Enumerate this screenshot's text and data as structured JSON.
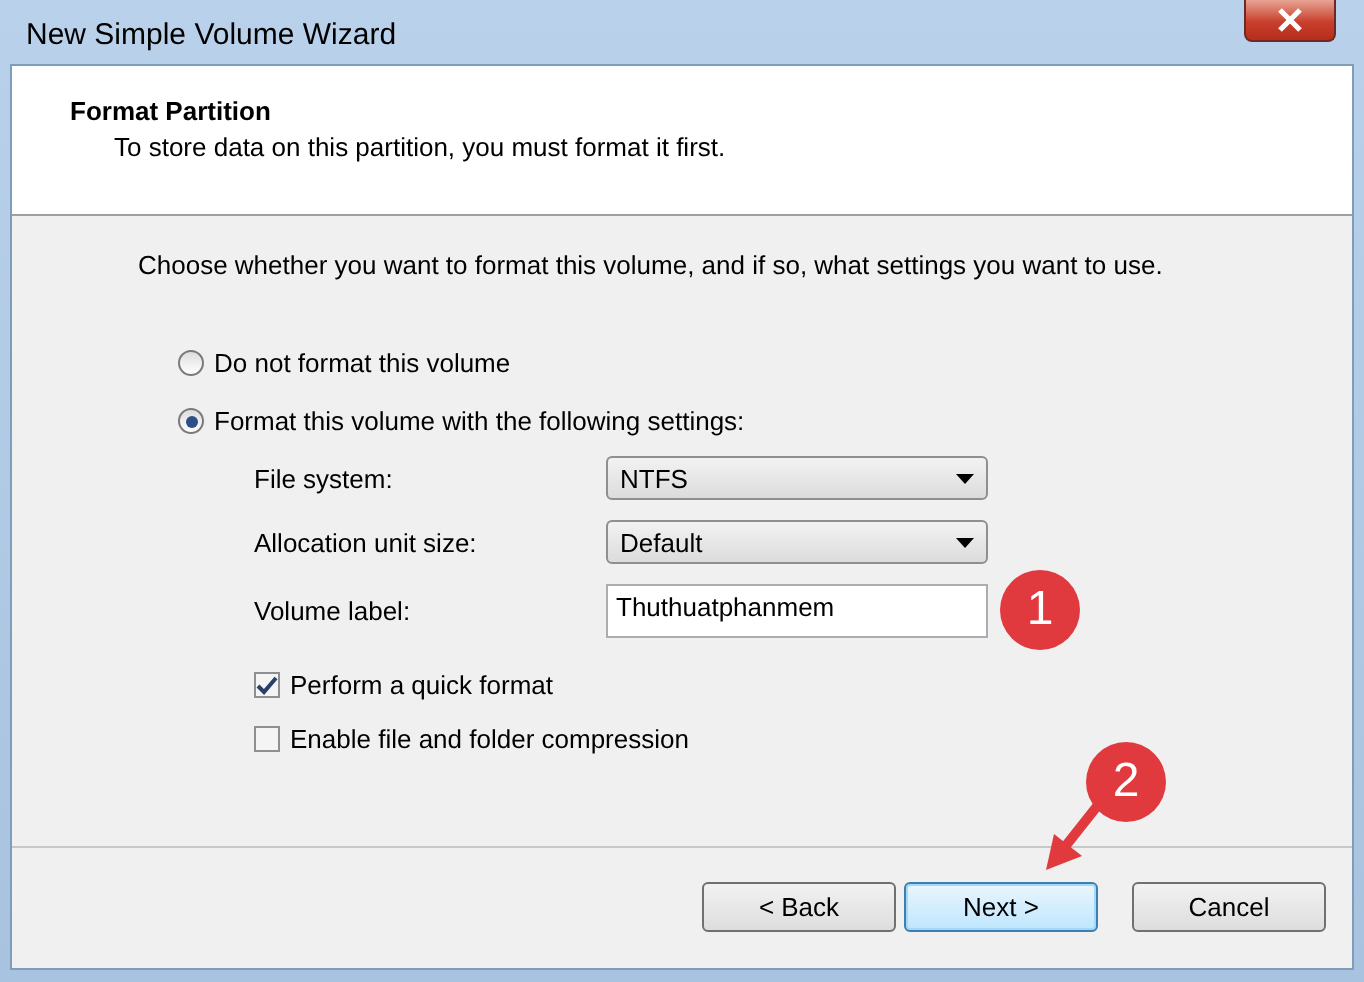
{
  "window": {
    "title": "New Simple Volume Wizard"
  },
  "header": {
    "title": "Format Partition",
    "subtitle": "To store data on this partition, you must format it first."
  },
  "instruction": "Choose whether you want to format this volume, and if so, what settings you want to use.",
  "options": [
    {
      "label": "Do not format this volume",
      "selected": false
    },
    {
      "label": "Format this volume with the following settings:",
      "selected": true
    }
  ],
  "settings": [
    {
      "kind": "dropdown",
      "label": "File system:",
      "value": "NTFS"
    },
    {
      "kind": "dropdown",
      "label": "Allocation unit size:",
      "value": "Default"
    },
    {
      "kind": "text",
      "label": "Volume label:",
      "value": "Thuthuatphanmem"
    }
  ],
  "checkboxes": [
    {
      "label": "Perform a quick format",
      "checked": true
    },
    {
      "label": "Enable file and folder compression",
      "checked": false
    }
  ],
  "buttons": [
    {
      "label": "< Back",
      "focused": false
    },
    {
      "label": "Next >",
      "focused": true
    },
    {
      "label": "Cancel",
      "focused": false
    }
  ],
  "annotations": [
    {
      "label": "1",
      "arrow": false
    },
    {
      "label": "2",
      "arrow": true
    }
  ]
}
